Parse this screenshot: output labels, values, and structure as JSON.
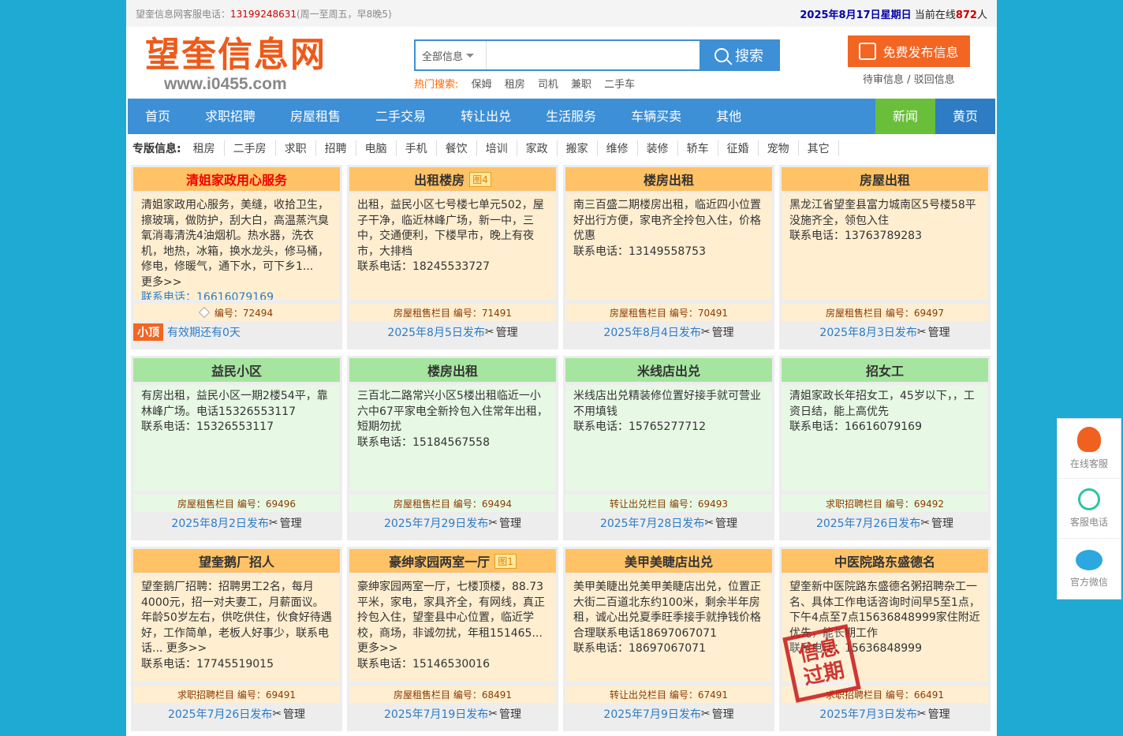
{
  "topbar": {
    "service_label": "望奎信息网客服电话：",
    "service_phone": "13199248631",
    "service_hours": "(周一至周五，早8晚5)",
    "date": "2025年8月17日星期日",
    "online_prefix": "当前在线",
    "online_count": "872",
    "online_suffix": "人"
  },
  "logo": {
    "title": "望奎信息网",
    "url": "www.i0455.com"
  },
  "search": {
    "category": "全部信息",
    "placeholder": "",
    "button": "搜索",
    "hot_label": "热门搜索:",
    "hot_keywords": [
      "保姆",
      "租房",
      "司机",
      "兼职",
      "二手车"
    ]
  },
  "post": {
    "button": "免费发布信息",
    "pending": "待审信息",
    "sep": "/",
    "rejected": "驳回信息"
  },
  "nav": {
    "items": [
      "首页",
      "求职招聘",
      "房屋租售",
      "二手交易",
      "转让出兑",
      "生活服务",
      "车辆买卖",
      "其他"
    ],
    "news": "新闻",
    "yellow": "黄页"
  },
  "zhuan": {
    "title": "专版信息:",
    "tags": [
      "租房",
      "二手房",
      "求职",
      "招聘",
      "电脑",
      "手机",
      "餐饮",
      "培训",
      "家政",
      "搬家",
      "维修",
      "装修",
      "轿车",
      "征婚",
      "宠物",
      "其它"
    ]
  },
  "manage_label": "管理",
  "more_label": "更多>>",
  "cards": [
    {
      "title": "清姐家政用心服务",
      "body": "清姐家政用心服务，美缝，收拾卫生，擦玻璃，做防护，刮大白，高温蒸汽臭氧消毒清洗4油烟机。热水器，洗衣机，地热，冰箱，换水龙头，修马桶，修电，修暖气，通下水，可下乡1...",
      "more": "更多>>",
      "phone": "联系电话：16616079169",
      "meta": "编号：72494",
      "top_badge": "小顶",
      "foot": "有效期还有0天"
    },
    {
      "title": "出租楼房",
      "img": "图4",
      "body": "出租，益民小区七号楼七单元502，屋子干净，临近林峰广场，新一中，三中，交通便利，下楼早市，晚上有夜市，大排档",
      "phone": "联系电话：18245533727",
      "meta": "房屋租售栏目 编号：71491",
      "foot": "2025年8月5日发布"
    },
    {
      "title": "楼房出租",
      "body": "南三百盛二期楼房出租，临近四小位置好出行方便，家电齐全拎包入住，价格优惠",
      "phone": "联系电话：13149558753",
      "meta": "房屋租售栏目 编号：70491",
      "foot": "2025年8月4日发布"
    },
    {
      "title": "房屋出租",
      "body": "黑龙江省望奎县富力城南区5号楼58平没施齐全，领包入住",
      "phone": "联系电话：13763789283",
      "meta": "房屋租售栏目 编号：69497",
      "foot": "2025年8月3日发布"
    },
    {
      "title": "益民小区",
      "body": "有房出租，益民小区一期2楼54平，靠林峰广场。电话15326553117",
      "phone": "联系电话：15326553117",
      "meta": "房屋租售栏目 编号：69496",
      "foot": "2025年8月2日发布"
    },
    {
      "title": "楼房出租",
      "body": "三百北二路常兴小区5楼出租临近一小六中67平家电全新拎包入住常年出租，短期勿扰",
      "phone": "联系电话：15184567558",
      "meta": "房屋租售栏目 编号：69494",
      "foot": "2025年7月29日发布"
    },
    {
      "title": "米线店出兑",
      "body": "米线店出兑精装修位置好接手就可营业不用填钱",
      "phone": "联系电话：15765277712",
      "meta": "转让出兑栏目 编号：69493",
      "foot": "2025年7月28日发布"
    },
    {
      "title": "招女工",
      "body": "清姐家政长年招女工，45岁以下，，工资日结，能上高优先",
      "phone": "联系电话：16616079169",
      "meta": "求职招聘栏目 编号：69492",
      "foot": "2025年7月26日发布"
    },
    {
      "title": "望奎鹅厂招人",
      "body": "望奎鹅厂招聘：招聘男工2名，每月4000元，招一对夫妻工，月薪面议。年龄50岁左右，供吃供住，伙食好待遇好，工作简单，老板人好事少，联系电话...",
      "more": "更多>>",
      "phone": "联系电话：17745519015",
      "meta": "求职招聘栏目 编号：69491",
      "foot": "2025年7月26日发布"
    },
    {
      "title": "豪绅家园两室一厅",
      "img": "图1",
      "body": "豪绅家园两室一厅，七楼顶楼，88.73平米，家电，家具齐全，有网线，真正拎包入住，望奎县中心位置，临近学校，商场，非诚勿扰，年租151465...",
      "more": "更多>>",
      "phone": "联系电话：15146530016",
      "meta": "房屋租售栏目 编号：68491",
      "foot": "2025年7月19日发布"
    },
    {
      "title": "美甲美睫店出兑",
      "body": "美甲美睫出兑美甲美睫店出兑，位置正大街二百道北东约100米，剩余半年房租，诚心出兑夏季旺季接手就挣钱价格合理联系电话18697067071",
      "phone": "联系电话：18697067071",
      "meta": "转让出兑栏目 编号：67491",
      "foot": "2025年7月9日发布"
    },
    {
      "title": "中医院路东盛德名",
      "body": "望奎新中医院路东盛德名粥招聘杂工一名、具体工作电话咨询时间早5至1点，下午4点至7点15636848999家住附近优先，能长期工作",
      "phone": "联系电话：15636848999",
      "meta": "求职招聘栏目 编号：66491",
      "foot": "2025年7月3日发布",
      "stamp": "信息过期"
    }
  ],
  "float": {
    "qq": "在线客服",
    "phone": "客服电话",
    "wechat": "官方微信"
  },
  "colors": {
    "bg": "#1eaad3",
    "nav": "#3d8fd6",
    "orange": "#ffc266",
    "green": "#a6e5a0",
    "accent": "#f26522"
  }
}
